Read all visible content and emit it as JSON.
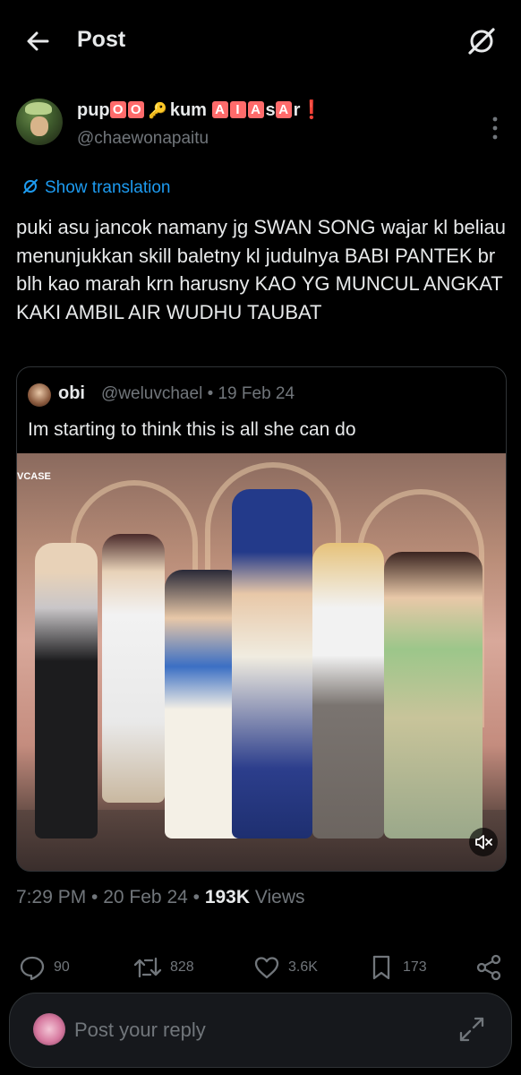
{
  "header": {
    "title": "Post",
    "back_icon": "arrow-left-icon",
    "grok_icon": "grok-icon"
  },
  "author": {
    "name_parts": [
      "pup",
      "O",
      "O",
      "🔑",
      "kum",
      "A",
      "I",
      "A",
      "s",
      "A",
      "r",
      "❗"
    ],
    "handle": "@chaewonapaitu"
  },
  "translate": {
    "label": "Show translation"
  },
  "tweet": {
    "text": "puki asu jancok namany jg SWAN SONG wajar kl beliau menunjukkan skill baletny kl judulnya BABI PANTEK br blh kao marah krn harusny KAO YG MUNCUL ANGKAT KAKI AMBIL AIR WUDHU TAUBAT"
  },
  "quote": {
    "name": "obi",
    "handle_date": "@weluvchael • 19 Feb 24",
    "text": "Im starting to think this is all she can do",
    "watermark": "VCASE"
  },
  "meta": {
    "time_date": "7:29 PM • 20 Feb 24 • ",
    "views": "193K",
    "views_label": " Views"
  },
  "actions": {
    "replies": "90",
    "reposts": "828",
    "likes": "3.6K",
    "bookmarks": "173"
  },
  "reply": {
    "placeholder": "Post your reply"
  },
  "colors": {
    "accent": "#1d9bf0",
    "muted": "#71767b",
    "text": "#e7e9ea",
    "background": "#000000"
  }
}
